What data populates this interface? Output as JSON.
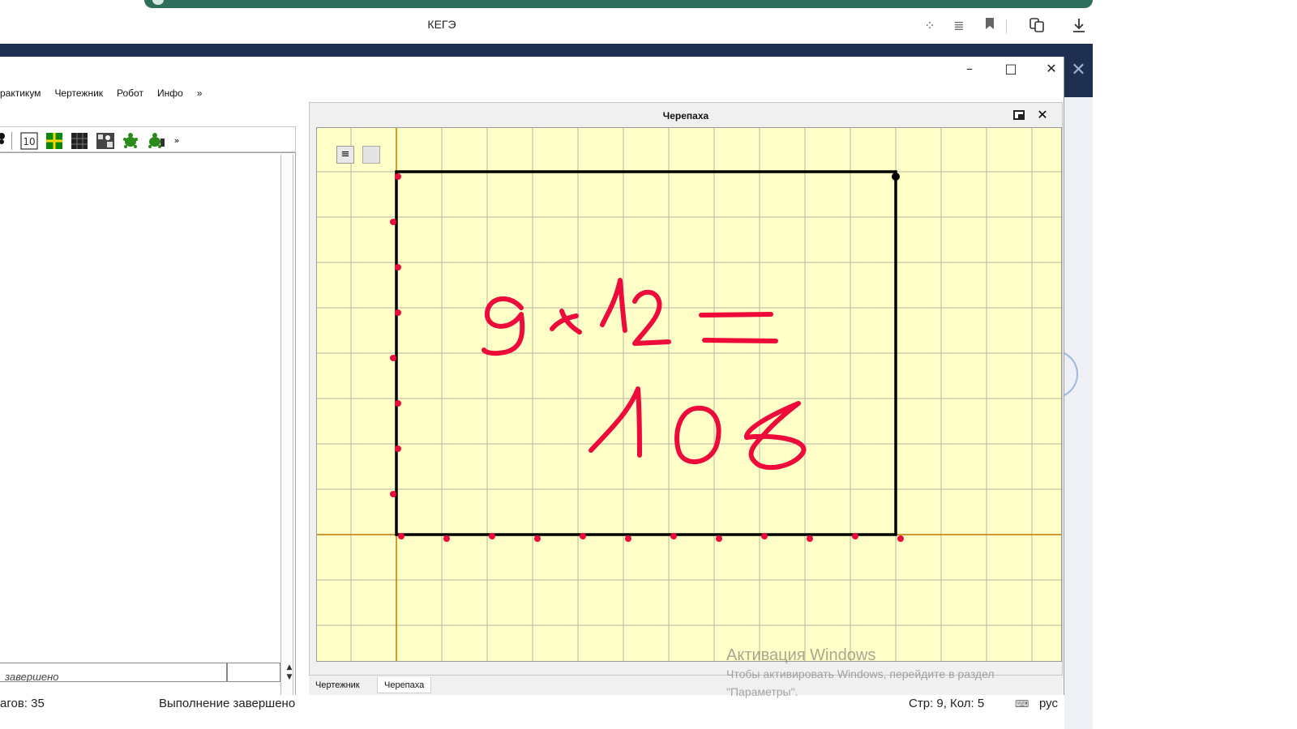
{
  "browser": {
    "title": "КЕГЭ",
    "icons": [
      "extensions-icon",
      "reader-icon",
      "bookmark-icon",
      "translate-icon",
      "download-icon"
    ]
  },
  "window": {
    "menu": [
      "рактикум",
      "Чертежник",
      "Робот",
      "Инфо",
      "»"
    ],
    "controls": {
      "minimize": "–",
      "maximize": "□",
      "close": "✕"
    }
  },
  "toolbar": {
    "icons": [
      "program-icon",
      "field-10-icon",
      "grid-green-icon",
      "grid-black-icon",
      "robot-field-icon",
      "turtle-icon",
      "turtle-step-icon",
      "more-icon"
    ],
    "more": "»"
  },
  "editor": {
    "status_text": "завершено"
  },
  "panel": {
    "title": "Черепаха",
    "close": "✕",
    "menu_glyph": "≡"
  },
  "tabs": [
    "Чертежник",
    "Черепаха"
  ],
  "statusbar": {
    "steps": "агов: 35",
    "message": "Выполнение завершено",
    "position": "Стр: 9, Кол: 5",
    "keyboard": "рус"
  },
  "annotation": {
    "line1": "9 × 12 =",
    "line2": "108",
    "color": "#ee0a3a"
  },
  "turtle_drawing": {
    "grid_columns": 16,
    "grid_rows": 11.5,
    "rectangle_width_cells": 11,
    "rectangle_height_cells": 8
  },
  "colors": {
    "canvas": "#ffffc8",
    "grid": "#b5b5a0",
    "axis": "#c07800",
    "drawing": "#000000",
    "navy": "#1e2f52"
  },
  "watermark": {
    "title": "Активация Windows",
    "subtitle": "Чтобы активировать Windows, перейдите в раздел \"Параметры\"."
  }
}
